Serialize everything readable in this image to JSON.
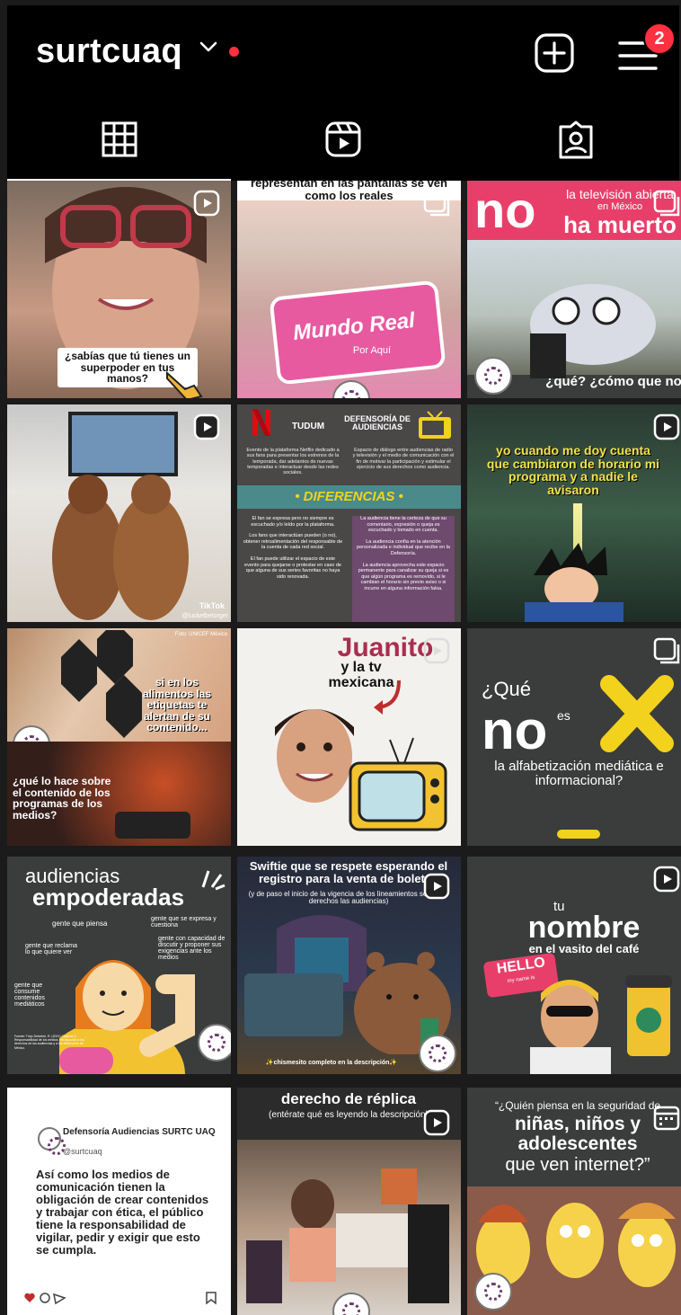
{
  "profile": {
    "username": "surtcuaq",
    "notification_count": "2"
  },
  "posts": {
    "p1": {
      "caption": "¿sabías que tú tienes un superpoder en tus manos?"
    },
    "p2": {
      "header": "representan en las pantallas se ven como los reales",
      "sign": "Mundo Real",
      "sign_sub": "Por Aquí"
    },
    "p3": {
      "big": "no",
      "top": "la televisión abierta",
      "small": "en México",
      "right": "ha muerto",
      "bottom": "¿qué? ¿cómo que no?"
    },
    "p4": {
      "watermark": "TikTok",
      "handle": "@lucketbetorger"
    },
    "p5": {
      "left_title": "TUDUM",
      "right_title": "DEFENSORÍA DE AUDIENCIAS",
      "left_intro": "Evento de la plataforma Netflix dedicado a sus fans para presentar los estrenos de la temporada, dar adelantos de nuevas temporadas e interactuar desde las redes sociales.",
      "right_intro": "Espacio de diálogo entre audiencias de radio y televisión y el medio de comunicación con el fin de motivar la participación y estimular el ejercicio de sus derechos como audiencia.",
      "band": "• DIFERENCIAS •",
      "left_points": [
        "El fan se expresa pero no siempre es escuchado y/o leído por la plataforma.",
        "Los fans que interactúan pueden (o no), obtener retroalimentación del responsable de la cuenta de cada red social.",
        "El fan puede utilizar el espacio de este evento para quejarse o protestar en caso de que alguna de sus series favoritas no haya sido renovada."
      ],
      "right_points": [
        "La audiencia tiene la certeza de que su comentario, expresión o queja es escuchado y tomado en cuenta.",
        "La audiencia confía en la atención personalizada e individual que recibe en la Defensoría.",
        "La audiencia aprovecha este espacio permanente para canalizar su queja si es que algún programa es removido, si le cambian el horario sin previo aviso o si incurre en alguna información falsa."
      ]
    },
    "p6": {
      "caption": "yo cuando me doy cuenta que cambiaron de horario mi programa y a nadie le avisaron"
    },
    "p7": {
      "label_top": "Foto: UNICEF México",
      "caption1": "si en los alimentos las etiquetas te alertan de su contenido...",
      "caption2": "¿qué lo hace sobre el contenido de los programas de los medios?"
    },
    "p8": {
      "title": "Juanito",
      "subtitle": "y la tv mexicana"
    },
    "p9": {
      "line1": "¿Qué",
      "big": "no",
      "es": "es",
      "bottom": "la alfabetización mediática e informacional?"
    },
    "p10": {
      "title_light": "audiencias",
      "title_bold": "empoderadas",
      "points": [
        "gente que piensa",
        "gente que se expresa y cuestiona",
        "gente que reclama lo que quiere ver",
        "gente con capacidad de discutir y proponer sus exigencias ante los medios",
        "gente que consume contenidos mediáticos"
      ],
      "source": "Fuente: Trejo Delarbre, R. (2021) Capítulo 3. Responsabilidad de los medios. Introducción a los derechos de las audiencias y a los defensores de México."
    },
    "p11": {
      "title": "Swiftie que se respete esperando el registro para la venta de boletos",
      "sub": "(y de paso el inicio de la vigencia de los lineamientos sobre los derechos las audiencias)",
      "footer": "✨chismesito completo en la descripción✨"
    },
    "p12": {
      "line1": "tu",
      "big": "nombre",
      "line3": "en el vasito del café",
      "sticker": "HELLO",
      "sticker_sub": "my name is"
    },
    "p13": {
      "account": "Defensoría Audiencias SURTC UAQ",
      "handle": "@surtcuaq",
      "body": "Así como los medios de comunicación tienen la obligación de crear contenidos y trabajar con ética, el público tiene la responsabilidad de vigilar, pedir y exigir que esto se cumpla."
    },
    "p14": {
      "title": "derecho de réplica",
      "sub": "(entérate qué es leyendo la descripción)"
    },
    "p15": {
      "line1": "“¿Quién piensa en la seguridad de",
      "line2": "niñas, niños y",
      "line3": "adolescentes",
      "line4": "que ven internet?”"
    }
  },
  "colors": {
    "accent_red": "#ff3040",
    "brand_dark": "#3a3d3c",
    "brand_yellow": "#f2d21c",
    "brand_purple": "#6b3b6b"
  },
  "icons": {
    "grid_tab": "grid-icon",
    "reels_tab": "reels-icon",
    "tagged_tab": "tagged-icon",
    "create": "plus-square-icon",
    "menu": "hamburger-menu-icon"
  }
}
